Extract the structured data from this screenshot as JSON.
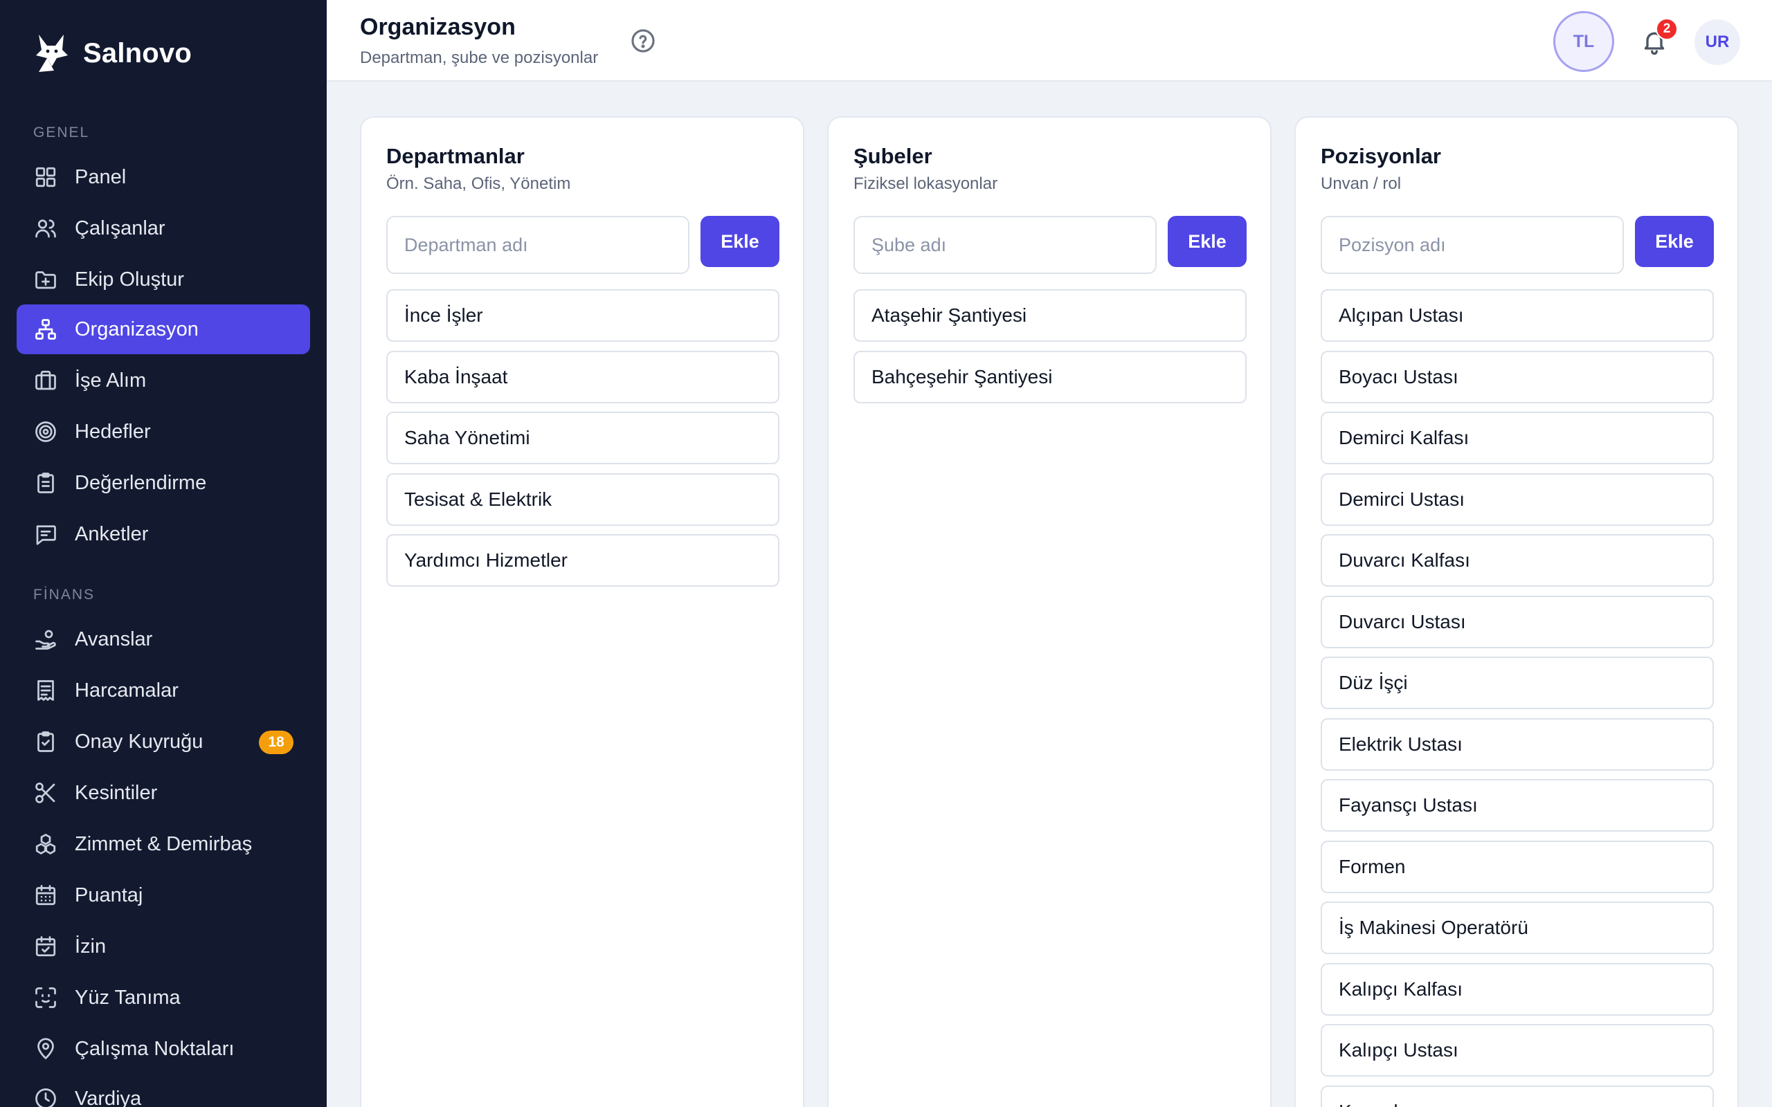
{
  "brand": {
    "name": "Salnovo"
  },
  "sidebar": {
    "sections": [
      {
        "label": "GENEL"
      },
      {
        "label": "FİNANS"
      }
    ],
    "items": [
      {
        "label": "Panel",
        "icon": "grid-icon"
      },
      {
        "label": "Çalışanlar",
        "icon": "users-icon"
      },
      {
        "label": "Ekip Oluştur",
        "icon": "folder-plus-icon"
      },
      {
        "label": "Organizasyon",
        "icon": "org-chart-icon",
        "active": true
      },
      {
        "label": "İşe Alım",
        "icon": "briefcase-icon"
      },
      {
        "label": "Hedefler",
        "icon": "target-icon"
      },
      {
        "label": "Değerlendirme",
        "icon": "clipboard-list-icon"
      },
      {
        "label": "Anketler",
        "icon": "message-square-icon"
      },
      {
        "label": "Avanslar",
        "icon": "hand-coins-icon"
      },
      {
        "label": "Harcamalar",
        "icon": "receipt-icon"
      },
      {
        "label": "Onay Kuyruğu",
        "icon": "clipboard-check-icon",
        "badge": "18"
      },
      {
        "label": "Kesintiler",
        "icon": "scissors-icon"
      },
      {
        "label": "Zimmet & Demirbaş",
        "icon": "boxes-icon"
      },
      {
        "label": "Puantaj",
        "icon": "calendar-grid-icon"
      },
      {
        "label": "İzin",
        "icon": "calendar-check-icon"
      },
      {
        "label": "Yüz Tanıma",
        "icon": "face-scan-icon"
      },
      {
        "label": "Çalışma Noktaları",
        "icon": "map-pin-icon"
      },
      {
        "label": "Vardiya",
        "icon": "clock-icon"
      }
    ]
  },
  "header": {
    "title": "Organizasyon",
    "subtitle": "Departman, şube ve pozisyonlar",
    "user_initials": "TL",
    "notification_count": "2",
    "account_initials": "UR"
  },
  "colors": {
    "accent": "#4f46e5",
    "sidebar_bg": "#131a30",
    "badge_warning": "#f59e0b",
    "badge_danger": "#ef2b2b"
  },
  "cards": [
    {
      "title": "Departmanlar",
      "subtitle": "Örn. Saha, Ofis, Yönetim",
      "input_placeholder": "Departman adı",
      "add_label": "Ekle",
      "items": [
        "İnce İşler",
        "Kaba İnşaat",
        "Saha Yönetimi",
        "Tesisat & Elektrik",
        "Yardımcı Hizmetler"
      ]
    },
    {
      "title": "Şubeler",
      "subtitle": "Fiziksel lokasyonlar",
      "input_placeholder": "Şube adı",
      "add_label": "Ekle",
      "items": [
        "Ataşehir Şantiyesi",
        "Bahçeşehir Şantiyesi"
      ]
    },
    {
      "title": "Pozisyonlar",
      "subtitle": "Unvan / rol",
      "input_placeholder": "Pozisyon adı",
      "add_label": "Ekle",
      "items": [
        "Alçıpan Ustası",
        "Boyacı Ustası",
        "Demirci Kalfası",
        "Demirci Ustası",
        "Duvarcı Kalfası",
        "Duvarcı Ustası",
        "Düz İşçi",
        "Elektrik Ustası",
        "Fayansçı Ustası",
        "Formen",
        "İş Makinesi Operatörü",
        "Kalıpçı Kalfası",
        "Kalıpçı Ustası",
        "Kaynakçı"
      ]
    }
  ]
}
